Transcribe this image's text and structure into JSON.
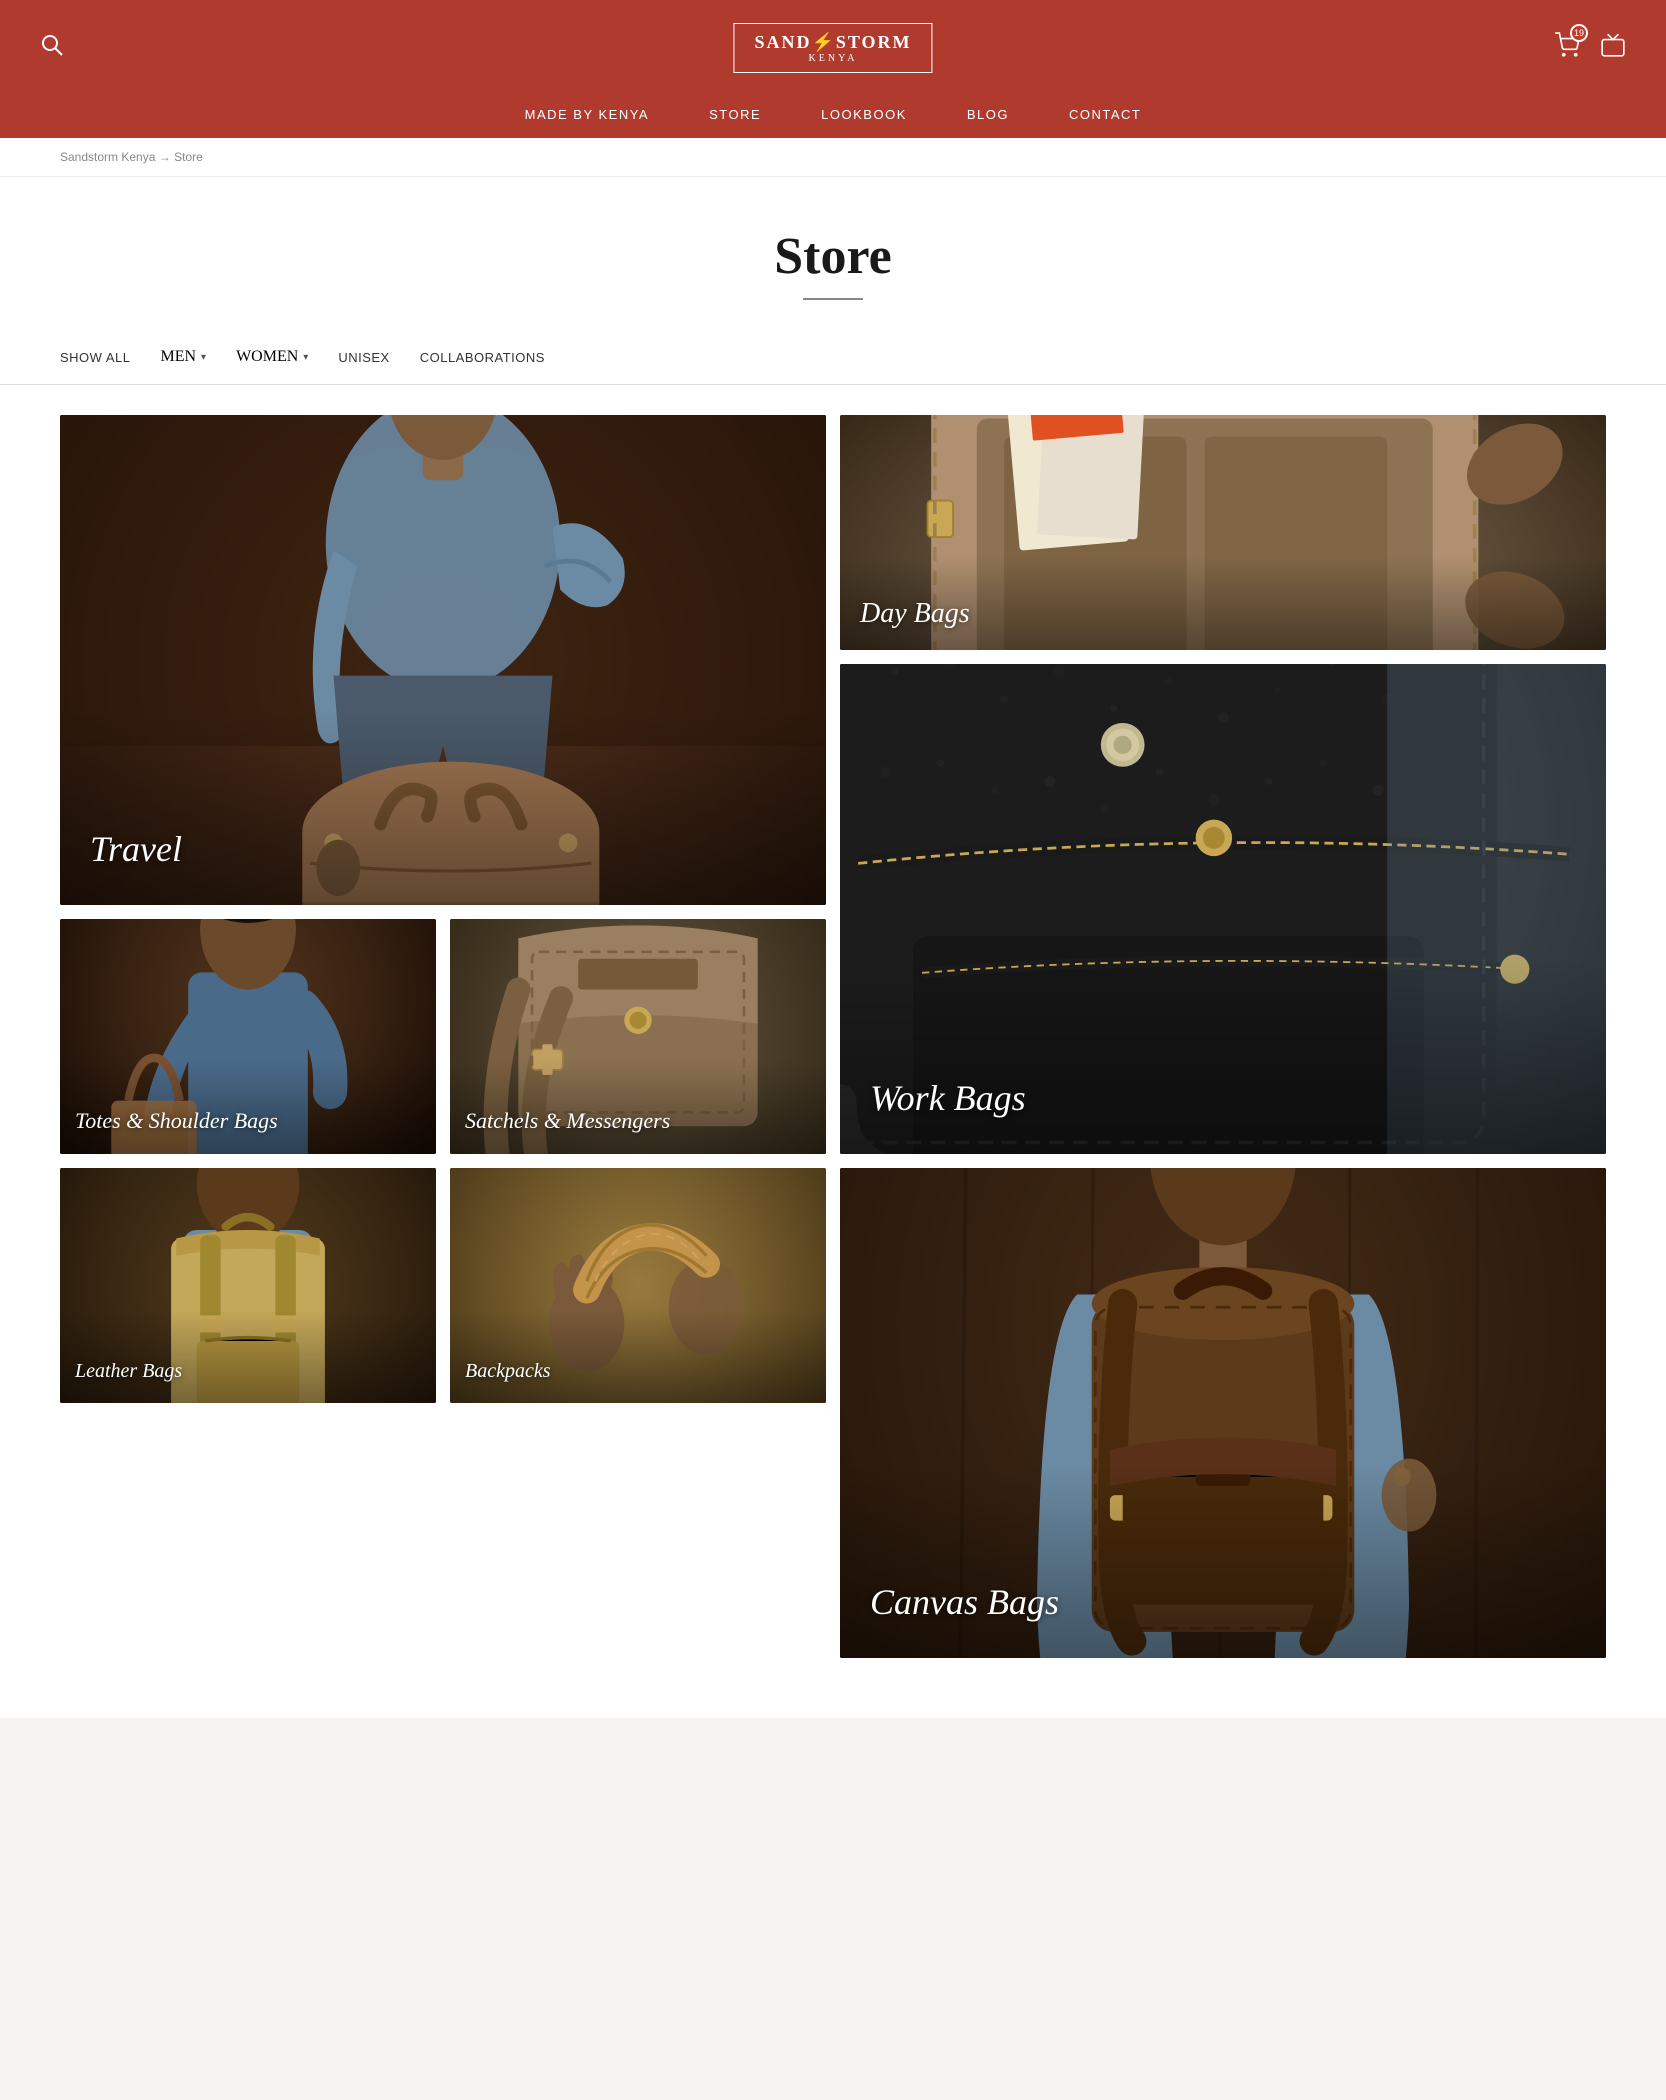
{
  "header": {
    "logo_line1": "SAND⚡STORM",
    "logo_line2": "KENYA",
    "cart_count": "19",
    "search_icon": "🔍",
    "cart_icon": "🛒",
    "tv_icon": "📺"
  },
  "nav": {
    "items": [
      {
        "label": "MADE BY KENYA",
        "href": "#"
      },
      {
        "label": "STORE",
        "href": "#"
      },
      {
        "label": "LOOKBOOK",
        "href": "#"
      },
      {
        "label": "BLOG",
        "href": "#"
      },
      {
        "label": "CONTACT",
        "href": "#"
      }
    ]
  },
  "breadcrumb": {
    "home": "Sandstorm Kenya",
    "separator": "→",
    "current": "Store"
  },
  "page": {
    "title": "Store"
  },
  "filters": {
    "items": [
      {
        "label": "SHOW ALL"
      },
      {
        "label": "MEN",
        "dropdown": true
      },
      {
        "label": "WOMEN",
        "dropdown": true
      },
      {
        "label": "UNISEX"
      },
      {
        "label": "COLLABORATIONS"
      }
    ]
  },
  "categories": [
    {
      "id": "travel",
      "label": "Travel"
    },
    {
      "id": "day-bags",
      "label": "Day Bags"
    },
    {
      "id": "work-bags",
      "label": "Work Bags"
    },
    {
      "id": "totes",
      "label": "Totes & Shoulder Bags"
    },
    {
      "id": "satchels",
      "label": "Satchels & Messengers"
    },
    {
      "id": "canvas",
      "label": "Canvas Bags"
    },
    {
      "id": "leather",
      "label": "Leather Bags"
    },
    {
      "id": "backpacks",
      "label": "Backpacks"
    }
  ],
  "colors": {
    "header_bg": "#b03a2e",
    "brand_red": "#b03a2e"
  }
}
